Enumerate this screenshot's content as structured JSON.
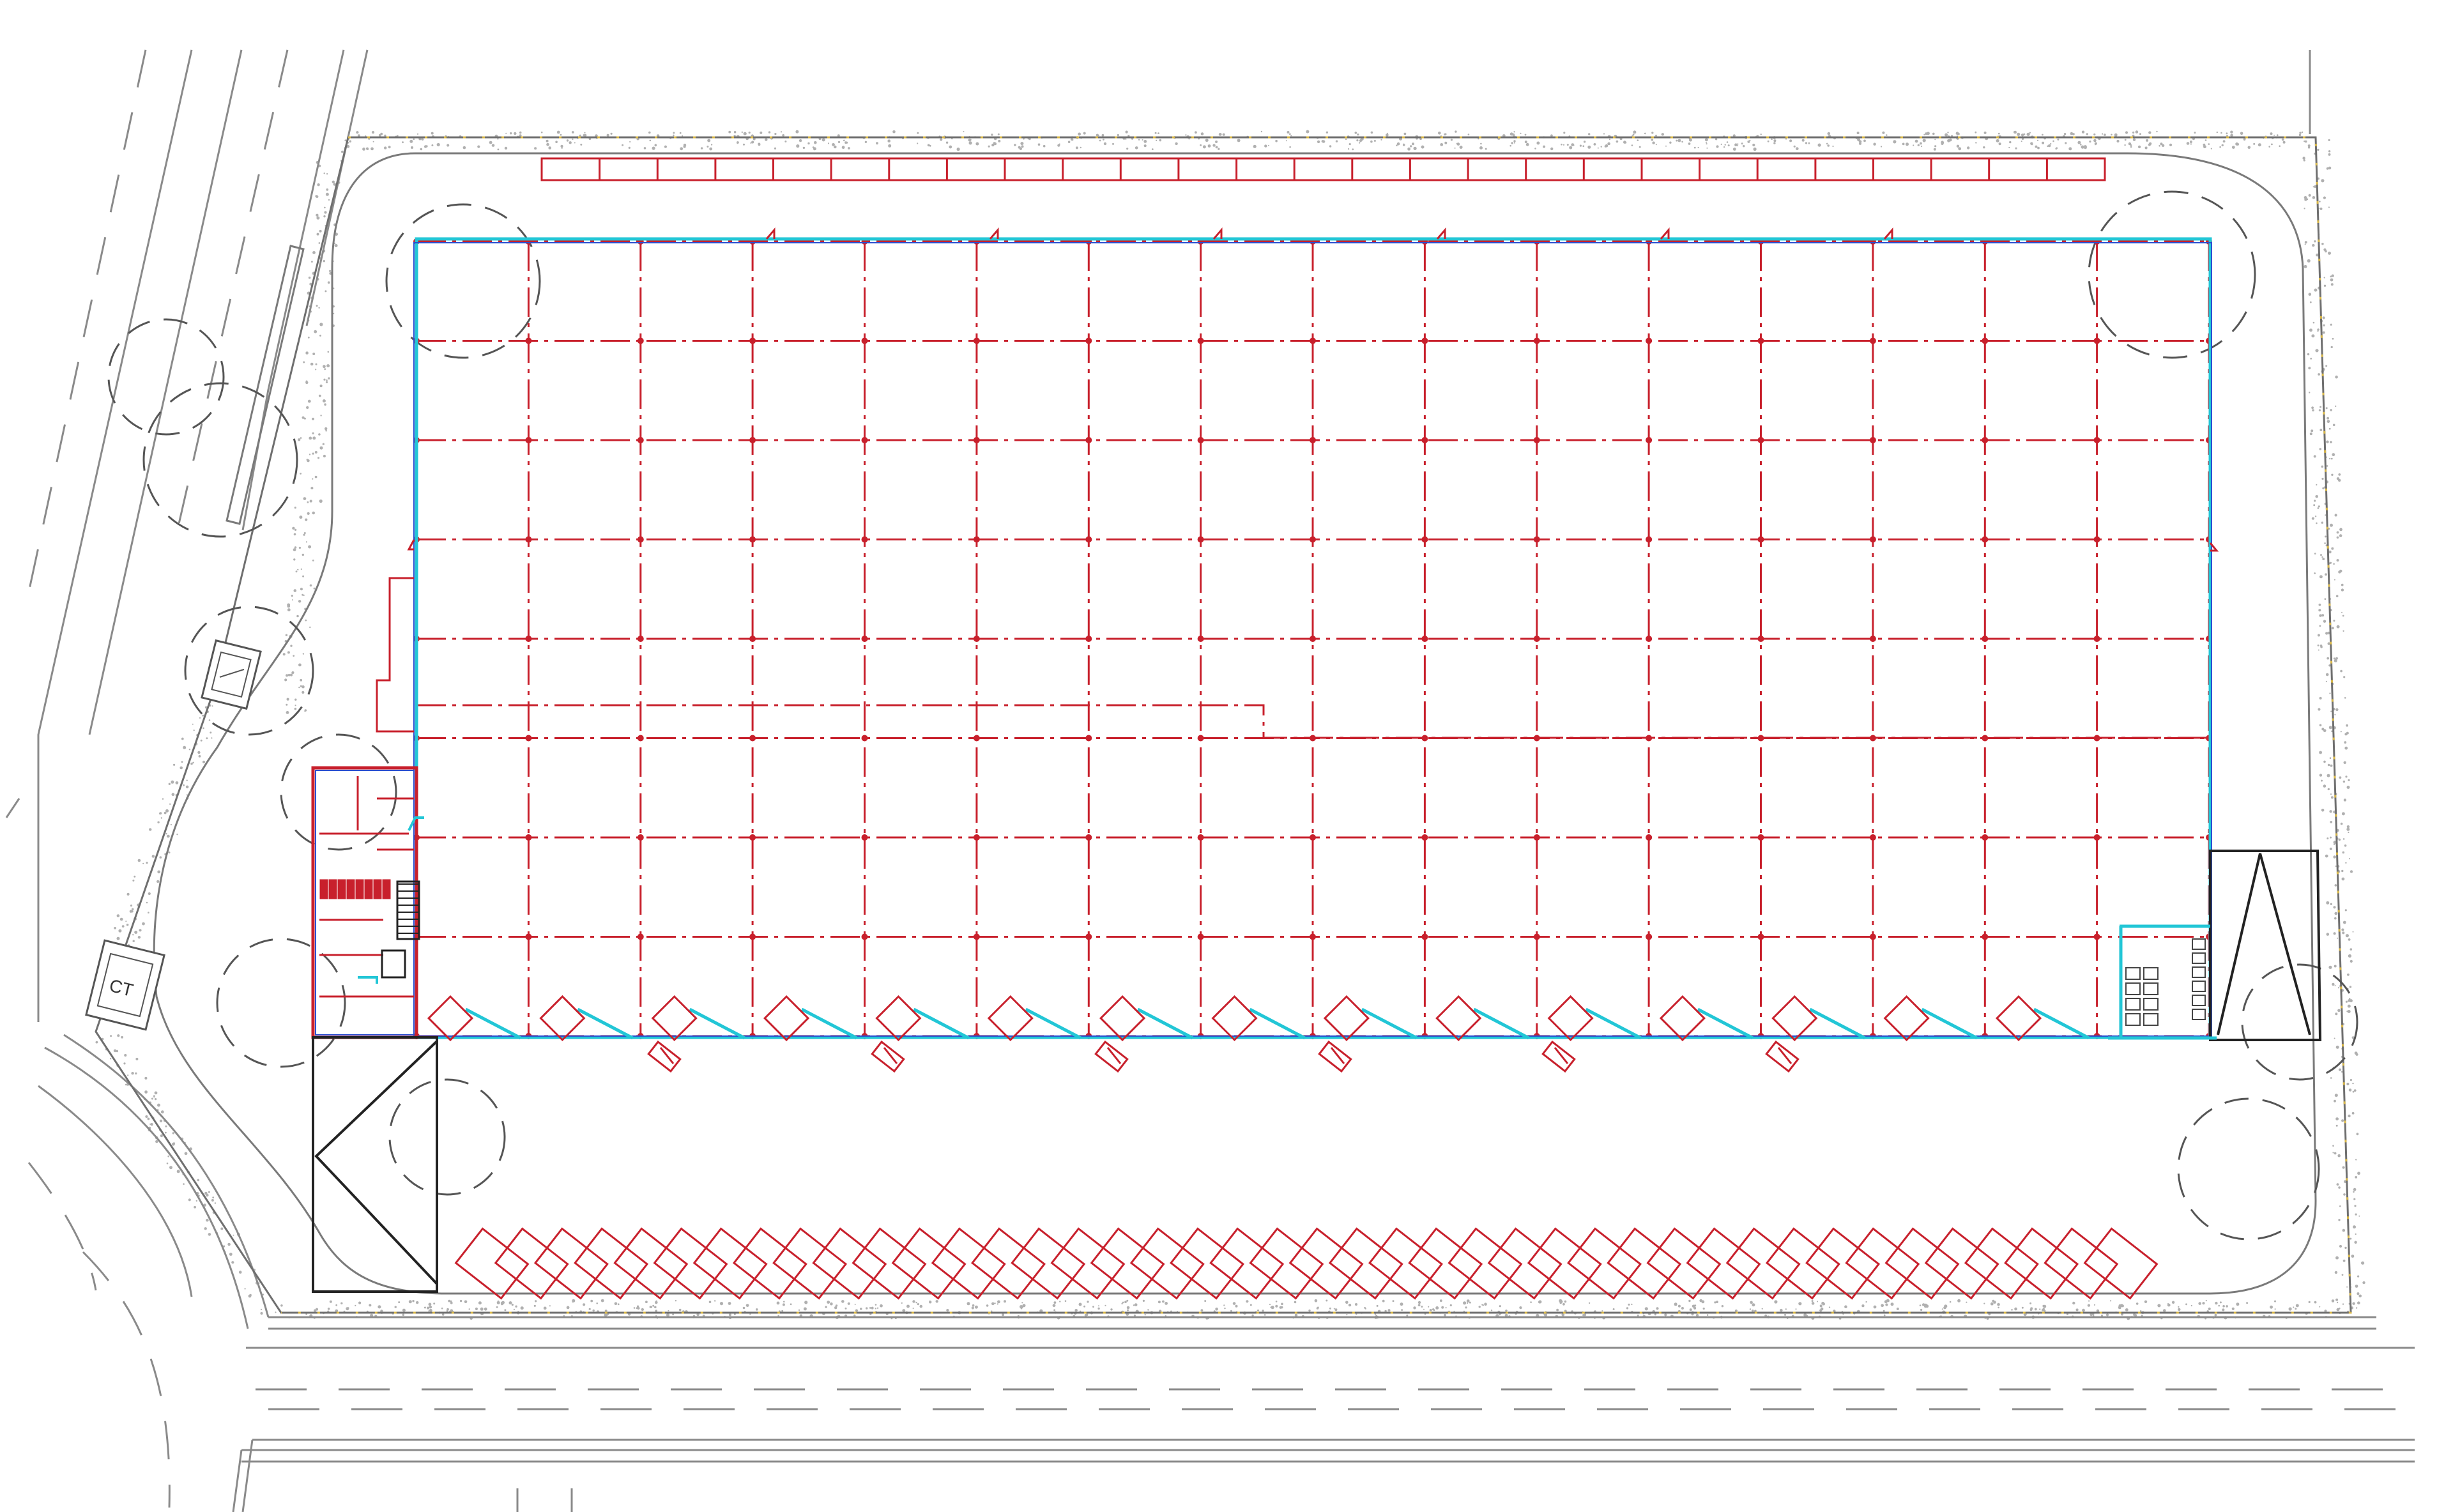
{
  "drawing": {
    "type": "site-plan",
    "transformer_label": "CT",
    "colors": {
      "background": "#ffffff",
      "road_lines": "#8a8a8a",
      "boundary_dots": "#d9b84a",
      "structure_grid": "#c8202c",
      "facade": "#22c6d6",
      "facade_inner": "#2a4fd0",
      "gravel": "#b0b0b0",
      "black_lines": "#222222"
    },
    "warehouse": {
      "grid_columns": 16,
      "grid_rows": 8,
      "loading_docks_south": 15,
      "roof_vents_north": 6
    },
    "parking": {
      "north_spaces": 27,
      "south_spaces": 42
    }
  }
}
